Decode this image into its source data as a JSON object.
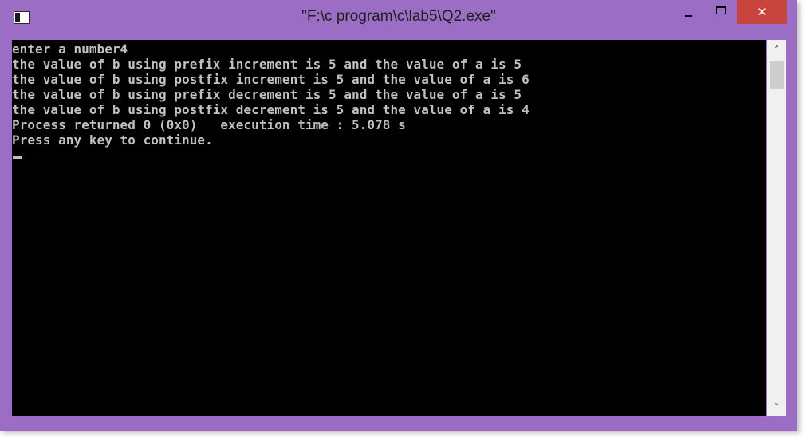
{
  "window": {
    "title": "\"F:\\c program\\c\\lab5\\Q2.exe\"",
    "close_glyph": "✕",
    "accent_color": "#9b6dc4",
    "close_color": "#c7453c"
  },
  "icons": {
    "app": "console-app-icon",
    "minimize": "minimize-icon",
    "maximize": "maximize-icon",
    "close": "close-icon",
    "scroll_up": "scroll-up-arrow-icon",
    "scroll_down": "scroll-down-arrow-icon"
  },
  "scrollbar": {
    "up_glyph": "˄",
    "down_glyph": "˅"
  },
  "console": {
    "lines": [
      "enter a number4",
      "the value of b using prefix increment is 5 and the value of a is 5",
      "the value of b using postfix increment is 5 and the value of a is 6",
      "the value of b using prefix decrement is 5 and the value of a is 5",
      "the value of b using postfix decrement is 5 and the value of a is 4",
      "Process returned 0 (0x0)   execution time : 5.078 s",
      "Press any key to continue."
    ]
  }
}
